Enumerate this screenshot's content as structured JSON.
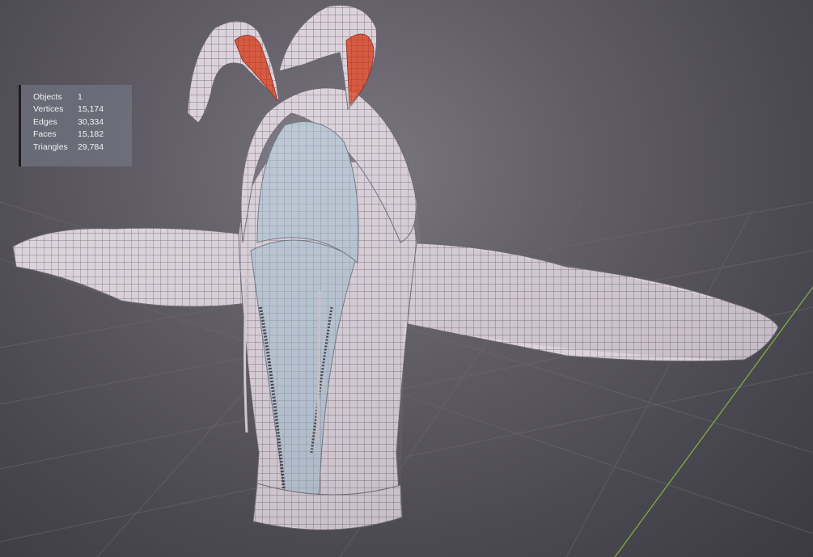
{
  "stats": {
    "rows": [
      {
        "label": "Objects",
        "value": "1"
      },
      {
        "label": "Vertices",
        "value": "15,174"
      },
      {
        "label": "Edges",
        "value": "30,334"
      },
      {
        "label": "Faces",
        "value": "15,182"
      },
      {
        "label": "Triangles",
        "value": "29,784"
      }
    ]
  },
  "colors": {
    "background": "#5e5b63",
    "grid_line": "#6e6c74",
    "y_axis": "#7fa640",
    "mesh_fill": "#d9cfd8",
    "mesh_wire": "#5b5660",
    "ear_inner": "#d9553c",
    "hood_inner": "#9fb7cc"
  },
  "icons": {
    "model": "hoodie-mesh-with-bunny-ears"
  }
}
